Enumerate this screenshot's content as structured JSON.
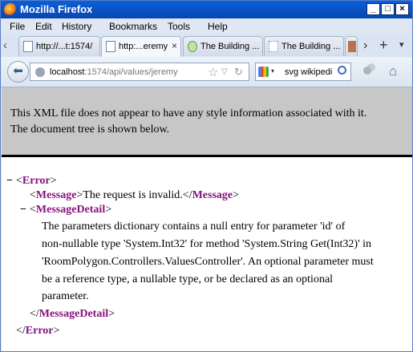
{
  "window": {
    "title": "Mozilla Firefox",
    "min": "_",
    "max": "□",
    "close": "×"
  },
  "menu": [
    "File",
    "Edit",
    "History",
    "Bookmarks",
    "Tools",
    "Help"
  ],
  "tabs": [
    {
      "label": "http://...t:1574/",
      "active": false
    },
    {
      "label": "http:...eremy",
      "active": true,
      "close": "×"
    },
    {
      "label": "The Building ...",
      "active": false
    },
    {
      "label": "The Building ...",
      "active": false
    }
  ],
  "toolbar": {
    "more": "›",
    "new_tab": "+",
    "list": "▾"
  },
  "address": {
    "host": "localhost",
    "path": ":1574/api/values/jeremy"
  },
  "search": {
    "value": "svg wikipedi"
  },
  "info": {
    "line1": "This XML file does not appear to have any style information associated with it.",
    "line2": "The document tree is shown below."
  },
  "xml": {
    "toggle": "−",
    "error_tag": "Error",
    "message_tag": "Message",
    "message_text": "The request is invalid.",
    "detail_tag": "MessageDetail",
    "detail_lines": [
      "The parameters dictionary contains a null entry for parameter 'id' of",
      "non-nullable type 'System.Int32' for method 'System.String Get(Int32)' in",
      "'RoomPolygon.Controllers.ValuesController'. An optional parameter must",
      "be a reference type, a nullable type, or be declared as an optional",
      "parameter."
    ]
  }
}
